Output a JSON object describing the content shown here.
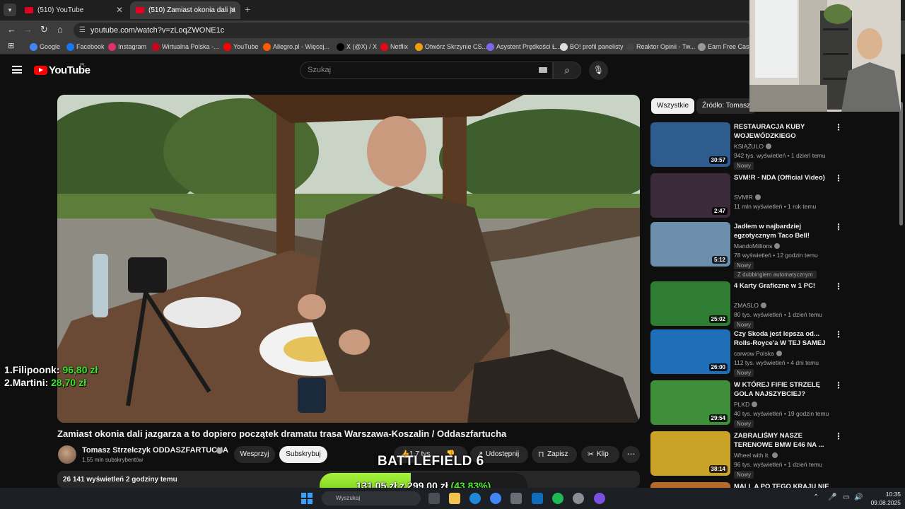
{
  "browser": {
    "tabs": [
      {
        "label": "(510) YouTube",
        "active": false
      },
      {
        "label": "(510) Zamiast okonia dali ja",
        "active": true
      }
    ],
    "url": "youtube.com/watch?v=zLoqZWONE1c",
    "bookmarks": [
      {
        "label": "Google",
        "color": "#4285f4"
      },
      {
        "label": "Facebook",
        "color": "#1877f2"
      },
      {
        "label": "Instagram",
        "color": "#e1306c"
      },
      {
        "label": "Wirtualna Polska -...",
        "color": "#d0021b"
      },
      {
        "label": "YouTube",
        "color": "#ff0000"
      },
      {
        "label": "Allegro.pl - Więcej...",
        "color": "#ff5a00"
      },
      {
        "label": "X (@X) / X",
        "color": "#000000"
      },
      {
        "label": "Netflix",
        "color": "#e50914"
      },
      {
        "label": "Otwórz Skrzynie CS...",
        "color": "#f39c12"
      },
      {
        "label": "Asystent Prędkości Ł...",
        "color": "#7b68ee"
      },
      {
        "label": "BO! profil panelisty",
        "color": "#dddddd"
      },
      {
        "label": "Reaktor Opinii - Tw...",
        "color": "#444444"
      },
      {
        "label": "Earn Free Cash C...",
        "color": "#999999"
      }
    ]
  },
  "youtube": {
    "logo_text": "YouTube",
    "region": "PL",
    "search_placeholder": "Szukaj"
  },
  "video": {
    "title": "Zamiast okonia dali jazgarza a to dopiero początek dramatu trasa Warszawa-Koszalin / Oddaszfartucha",
    "channel": "Tomasz Strzelczyk ODDASZFARTUCHA",
    "subscribers": "1,55 mln subskrybentów",
    "support_label": "Wesprzyj",
    "subscribe_label": "Subskrybuj",
    "likes": "1,7 tys.",
    "share_label": "Udostępnij",
    "save_label": "Zapisz",
    "clip_label": "Klip",
    "views_time": "26 141 wyświetleń  2 godziny temu"
  },
  "overlay": {
    "game_label": "BATTLEFIELD 6",
    "leaders": [
      {
        "rank": "1.",
        "name": "Filipoonk:",
        "amount": "96,80 zł"
      },
      {
        "rank": "2.",
        "name": "Martini:",
        "amount": "28,70 zł"
      }
    ],
    "goal": {
      "current": "131,05 zł",
      "sep": "z",
      "target": "299,00 zł",
      "percent": "(43.83%)",
      "fraction": 0.4383
    }
  },
  "sidebar": {
    "chips": [
      "Wszystkie",
      "Źródło: Tomasz"
    ],
    "recommendations": [
      {
        "title": "RESTAURACJA KUBY WOJEWÓDZKIEGO",
        "channel": "KSIĄŻULO",
        "meta": "942 tys. wyświetleń • 1 dzień temu",
        "badge": "Nowy",
        "duration": "30:57",
        "thumb_color": "#2e5c8f"
      },
      {
        "title": "SVM!R - NDA (Official Video)",
        "channel": "SVM!R",
        "meta": "11 mln wyświetleń • 1 rok temu",
        "badge": "",
        "duration": "2:47",
        "thumb_color": "#3b2a3a"
      },
      {
        "title": "Jadłem w najbardziej egzotycznym Taco Bell!",
        "channel": "MandoMillions",
        "meta": "78 wyświetleń • 12 godzin temu",
        "badge": "Nowy",
        "dub": "Z dubbingiem automatycznym",
        "duration": "5:12",
        "thumb_color": "#6d8fae"
      },
      {
        "title": "4 Karty Graficzne w 1 PC!",
        "channel": "ZMASLO",
        "meta": "80 tys. wyświetleń • 1 dzień temu",
        "badge": "Nowy",
        "duration": "25:02",
        "thumb_color": "#2e7d32"
      },
      {
        "title": "Czy Skoda jest lepsza od... Rolls-Royce'a W TEJ SAMEJ ...",
        "channel": "carwow Polska",
        "meta": "112 tys. wyświetleń • 4 dni temu",
        "badge": "Nowy",
        "duration": "26:00",
        "thumb_color": "#1e6fb8"
      },
      {
        "title": "W KTÓREJ FIFIE STRZELĘ GOLA NAJSZYBCIEJ?",
        "channel": "PLKD",
        "meta": "40 tys. wyświetleń • 19 godzin temu",
        "badge": "Nowy",
        "duration": "29:54",
        "thumb_color": "#3f8f3a"
      },
      {
        "title": "ZABRALIŚMY NASZE TERENOWE BMW E46 NA ...",
        "channel": "Wheel with it.",
        "meta": "96 tys. wyświetleń • 1 dzień temu",
        "badge": "Nowy",
        "duration": "38:14",
        "thumb_color": "#c9a227"
      },
      {
        "title": "MALL A PO TEGO KRAJU NIE",
        "channel": "",
        "meta": "",
        "badge": "",
        "duration": "",
        "thumb_color": "#b86a2a"
      }
    ]
  },
  "taskbar": {
    "search_placeholder": "Wyszukaj",
    "time": "10:35",
    "date": "09.08.2025"
  }
}
